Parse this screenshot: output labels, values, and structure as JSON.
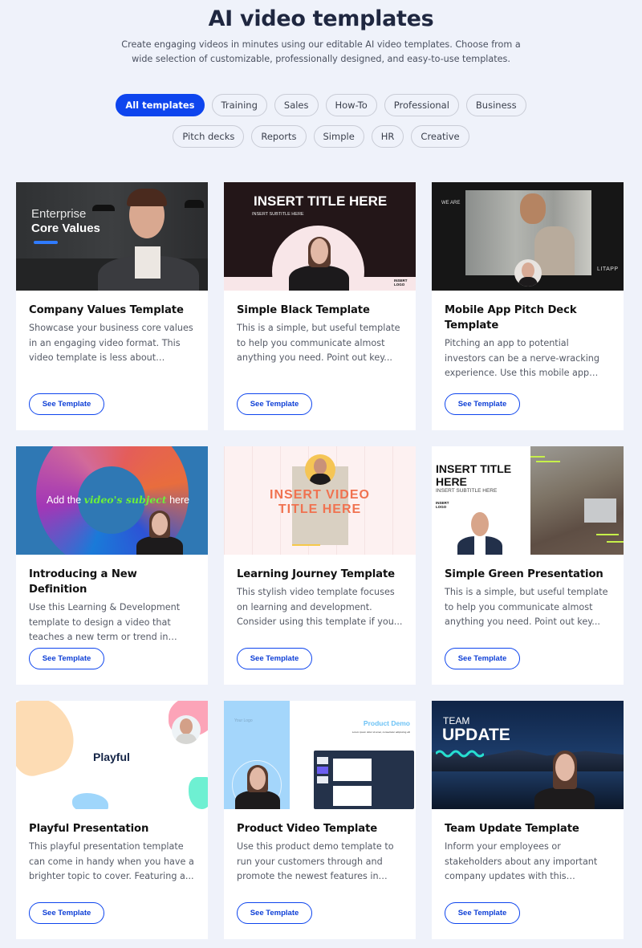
{
  "header": {
    "title": "AI video templates",
    "subtitle": "Create engaging videos in minutes using our editable AI video templates. Choose from a wide selection of customizable, professionally designed, and easy-to-use templates."
  },
  "filters": {
    "active": "All templates",
    "row1": [
      "All templates",
      "Training",
      "Sales",
      "How-To",
      "Professional",
      "Business"
    ],
    "row2": [
      "Pitch decks",
      "Reports",
      "Simple",
      "HR",
      "Creative"
    ]
  },
  "colors": {
    "accent": "#0e45ee",
    "background": "#eff2fa",
    "card": "#ffffff"
  },
  "cards": [
    {
      "title": "Company Values Template",
      "description": "Showcase your business core values in an engaging video format. This video template is less about telling...",
      "button": "See Template",
      "thumb": {
        "line1": "Enterprise",
        "line2": "Core Values"
      }
    },
    {
      "title": "Simple Black Template",
      "description": "This is a simple, but useful template to help you communicate almost anything you need. Point out key...",
      "button": "See Template",
      "thumb": {
        "line1": "INSERT TITLE HERE",
        "line2": "INSERT SUBTITLE HERE",
        "logo": "INSERT LOGO"
      }
    },
    {
      "title": "Mobile App Pitch Deck Template",
      "description": "Pitching an app to potential investors can be a nerve-wracking experience. Use this mobile app pit...",
      "button": "See Template",
      "thumb": {
        "line1": "WE ARE",
        "brand": "LITAPP"
      }
    },
    {
      "title": "Introducing a New Definition",
      "description": "Use this Learning & Development template to design a video that teaches a new term or trend in your...",
      "button": "See Template",
      "thumb": {
        "pre": "Add the",
        "highlight": "video's subject",
        "post": "here"
      }
    },
    {
      "title": "Learning Journey Template",
      "description": "This stylish video template focuses on learning and development. Consider using this template if you...",
      "button": "See Template",
      "thumb": {
        "line1": "INSERT VIDEO",
        "line2": "TITLE HERE"
      }
    },
    {
      "title": "Simple Green Presentation",
      "description": "This is a simple, but useful template to help you communicate almost anything you need. Point out key...",
      "button": "See Template",
      "thumb": {
        "line1": "INSERT TITLE HERE",
        "line2": "INSERT SUBTITLE HERE",
        "logo": "INSERT LOGO"
      }
    },
    {
      "title": "Playful Presentation",
      "description": "This playful presentation template can come in handy when you have a brighter topic to cover. Featuring a...",
      "button": "See Template",
      "thumb": {
        "line1": "Playful"
      }
    },
    {
      "title": "Product Video Template",
      "description": "Use this product demo template to run your customers through and promote the newest features in your...",
      "button": "See Template",
      "thumb": {
        "logo": "Your Logo",
        "line1": "Product Demo",
        "line2": "Lorem ipsum dolor sit amet, consectetur adipiscing elit"
      }
    },
    {
      "title": "Team Update Template",
      "description": "Inform your employees or stakeholders about any important company updates with this stunnin...",
      "button": "See Template",
      "thumb": {
        "line1": "TEAM",
        "line2": "UPDATE"
      }
    }
  ]
}
